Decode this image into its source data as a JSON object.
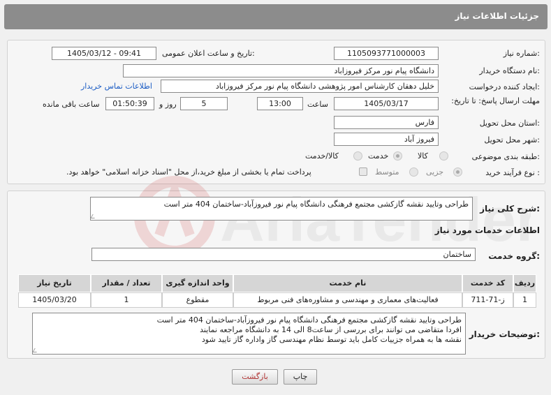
{
  "header": {
    "title": "جزئیات اطلاعات نیاز"
  },
  "fields": {
    "need_number_label": "شماره نیاز:",
    "need_number": "1105093771000003",
    "announce_label": "تاریخ و ساعت اعلان عمومی:",
    "announce_value": "1405/03/12 - 09:41",
    "buyer_org_label": "نام دستگاه خریدار:",
    "buyer_org": "دانشگاه پیام نور مرکز فیروزاباد",
    "creator_label": "ایجاد کننده درخواست:",
    "creator": "خلیل دهقان کارشناس امور پژوهشی دانشگاه پیام نور مرکز فیروزاباد",
    "contact_link": "اطلاعات تماس خریدار",
    "deadline_label": "مهلت ارسال پاسخ: تا تاریخ:",
    "deadline_date": "1405/03/17",
    "time_label": "ساعت",
    "deadline_time": "13:00",
    "days_value": "5",
    "days_label": "روز و",
    "remaining_value": "01:50:39",
    "remaining_label": "ساعت باقی مانده",
    "province_label": "استان محل تحویل:",
    "province": "فارس",
    "city_label": "شهر محل تحویل:",
    "city": "فیروز آباد",
    "category_label": "طبقه بندی موضوعی:",
    "category_options": [
      "کالا",
      "خدمت",
      "کالا/خدمت"
    ],
    "category_selected": "خدمت",
    "process_label": "نوع فرآیند خرید :",
    "process_options": [
      "جزیی",
      "متوسط"
    ],
    "process_selected": "جزیی",
    "payment_note": "پرداخت تمام یا بخشی از مبلغ خرید،از محل \"اسناد خزانه اسلامی\" خواهد بود."
  },
  "summary": {
    "label": "شرح کلی نیاز:",
    "text": "طراحی وتایید نقشه گازکشی مجتمع فرهنگی دانشگاه پیام نور فیروزآباد-ساختمان 404 متر است"
  },
  "services": {
    "heading": "اطلاعات خدمات مورد نیاز",
    "group_label": "گروه خدمت:",
    "group_value": "ساختمان",
    "columns": [
      "ردیف",
      "کد خدمت",
      "نام خدمت",
      "واحد اندازه گیری",
      "تعداد / مقدار",
      "تاریخ نیاز"
    ],
    "rows": [
      [
        "1",
        "ز-71-711",
        "فعالیت‌های معماری و مهندسی و مشاوره‌های فنی مربوط",
        "مقطوع",
        "1",
        "1405/03/20"
      ]
    ]
  },
  "notes": {
    "label": "توضیحات خریدار:",
    "text": "طراحی وتایید نقشه گازکشی مجتمع فرهنگی دانشگاه پیام نور فیروزآباد-ساختمان 404 متر است\nافردا متقاضی می توانند  برای بررسی از ساعت8 الی 14 به دانشگاه مراجعه نمایند\nنقشه ها به همراه جزییات کامل باید توسط نظام مهندسی گاز واداره گاز تایید شود"
  },
  "buttons": {
    "print": "چاپ",
    "back": "بازگشت"
  },
  "colors": {
    "header": "#8c8c8c",
    "link": "#1b5cc4",
    "back_text": "#b03030"
  }
}
